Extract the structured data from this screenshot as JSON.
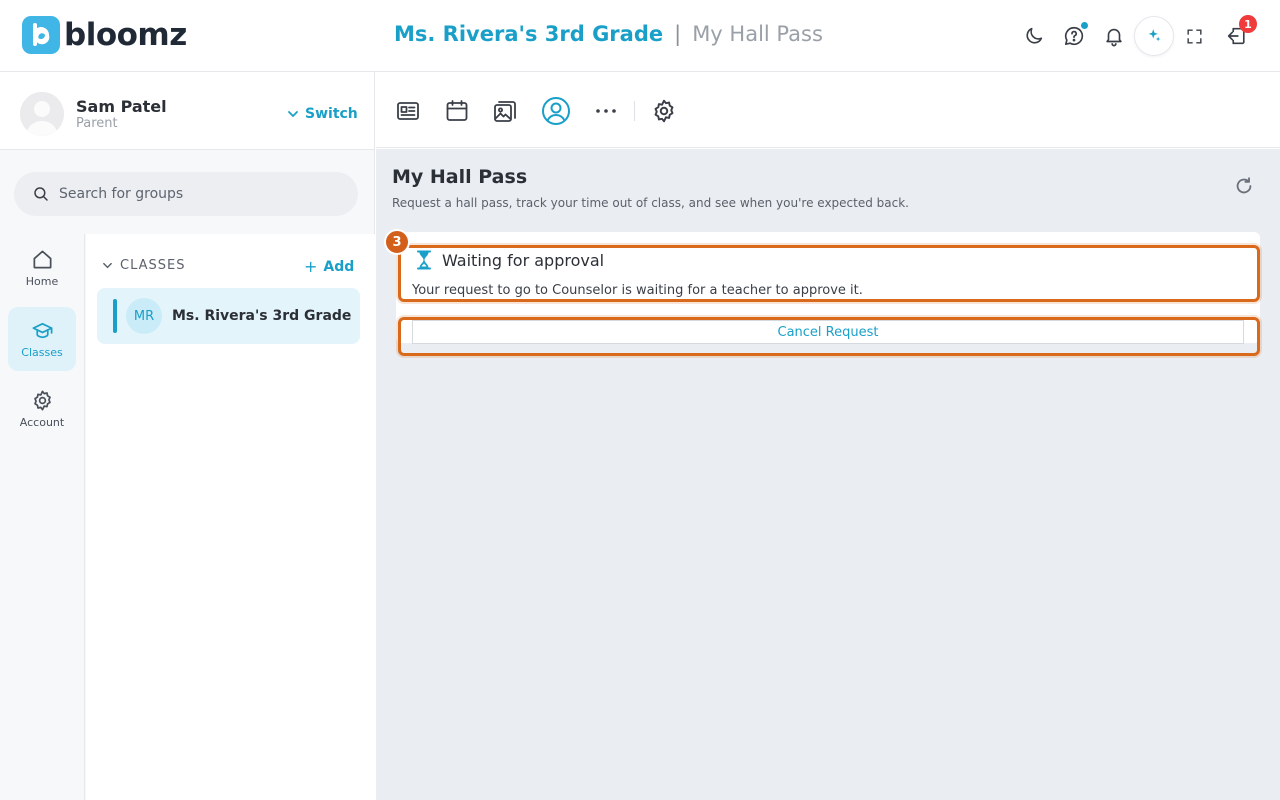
{
  "brand": {
    "name": "bloomz",
    "mark": "b",
    "color": "#3fb6e6"
  },
  "header": {
    "group_title": "Ms. Rivera's 3rd Grade",
    "separator": "|",
    "page_title": "My Hall Pass",
    "icons": [
      "moon-icon",
      "help-chat-icon",
      "bell-icon",
      "ai-sparkle-icon",
      "fullscreen-icon",
      "sign-out-icon"
    ],
    "notification_count": "1"
  },
  "user": {
    "name": "Sam Patel",
    "role": "Parent",
    "switch_label": "Switch"
  },
  "search": {
    "placeholder": "Search for groups"
  },
  "nav": {
    "items": [
      {
        "label": "Home",
        "icon": "home-icon"
      },
      {
        "label": "Classes",
        "icon": "graduation-cap-icon",
        "active": true
      },
      {
        "label": "Account",
        "icon": "gear-icon"
      }
    ]
  },
  "groups": {
    "section_label": "CLASSES",
    "add_label": "Add",
    "items": [
      {
        "initials": "MR",
        "name": "Ms. Rivera's 3rd Grade"
      }
    ]
  },
  "toolbar": {
    "icons": [
      "newsletter-icon",
      "calendar-icon",
      "photos-icon",
      "profile-icon",
      "more-icon",
      "settings-icon"
    ],
    "active": "profile-icon"
  },
  "main": {
    "title": "My Hall Pass",
    "subtitle": "Request a hall pass, track your time out of class, and see when you're expected back.",
    "status": {
      "title": "Waiting for approval",
      "message": "Your request to go to Counselor is waiting for a teacher to approve it."
    },
    "cancel_label": "Cancel Request",
    "step_number": "3"
  },
  "colors": {
    "accent": "#1aa0c8",
    "highlight": "#d96a1c",
    "alert": "#ef3b3b"
  }
}
